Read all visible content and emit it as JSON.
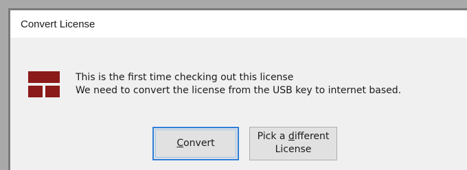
{
  "dialog": {
    "title": "Convert License",
    "icon": "license-grid-icon",
    "icon_color": "#8b1a1a",
    "message_line1": "This is the first time checking out this license",
    "message_line2": "We need to convert the license from the USB key to internet based."
  },
  "buttons": {
    "convert": {
      "mnemonic": "C",
      "rest": "onvert"
    },
    "pick_different": {
      "line1_prefix": "Pick a ",
      "line1_mnemonic": "d",
      "line1_rest": "ifferent",
      "line2": "License"
    }
  },
  "colors": {
    "focus_border": "#2f7ed8",
    "button_face": "#e1e1e1",
    "dialog_background": "#f0f0f0"
  }
}
